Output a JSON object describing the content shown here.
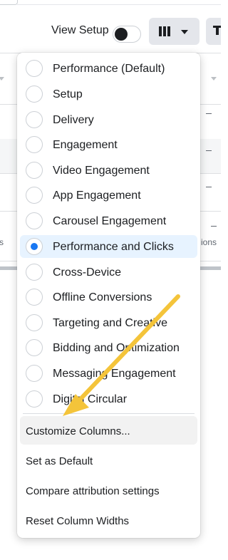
{
  "toolbar": {
    "view_setup_label": "View Setup",
    "view_setup_toggle": "on",
    "columns_icon": "columns-icon",
    "caret_icon": "chevron-down-icon"
  },
  "background_table": {
    "partial_text_left": "s",
    "partial_text_right": "ions",
    "placeholder_values": [
      "–",
      "–",
      "–",
      "–"
    ]
  },
  "columns_menu": {
    "presets": [
      {
        "label": "Performance (Default)",
        "selected": false
      },
      {
        "label": "Setup",
        "selected": false
      },
      {
        "label": "Delivery",
        "selected": false
      },
      {
        "label": "Engagement",
        "selected": false
      },
      {
        "label": "Video Engagement",
        "selected": false
      },
      {
        "label": "App Engagement",
        "selected": false
      },
      {
        "label": "Carousel Engagement",
        "selected": false
      },
      {
        "label": "Performance and Clicks",
        "selected": true
      },
      {
        "label": "Cross-Device",
        "selected": false
      },
      {
        "label": "Offline Conversions",
        "selected": false
      },
      {
        "label": "Targeting and Creative",
        "selected": false
      },
      {
        "label": "Bidding and Optimization",
        "selected": false
      },
      {
        "label": "Messaging Engagement",
        "selected": false
      },
      {
        "label": "Digital Circular",
        "selected": false
      }
    ],
    "actions": [
      {
        "label": "Customize Columns...",
        "hovered": true
      },
      {
        "label": "Set as Default",
        "hovered": false
      },
      {
        "label": "Compare attribution settings",
        "hovered": false
      },
      {
        "label": "Reset Column Widths",
        "hovered": false
      }
    ]
  },
  "colors": {
    "accent": "#1877f2",
    "selected_row": "#e7f3ff",
    "annotation_arrow": "#f4c43a"
  }
}
